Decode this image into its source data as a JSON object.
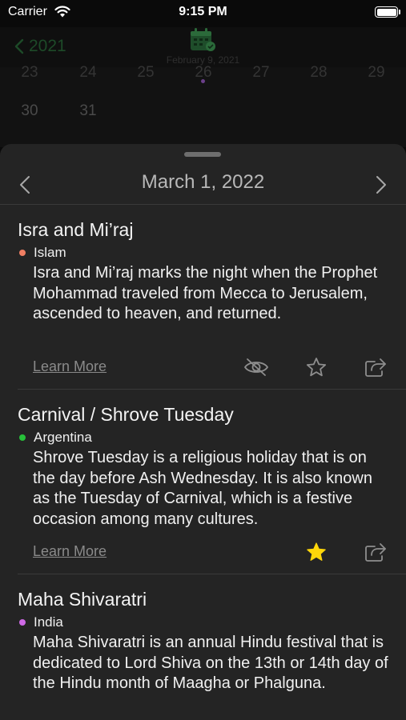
{
  "status_bar": {
    "carrier": "Carrier",
    "time": "9:15 PM",
    "battery_level": 1.0
  },
  "background_calendar": {
    "back_label": "2021",
    "selected_date": "February 9, 2021",
    "partial_row": [
      "23",
      "24",
      "25",
      "26",
      "27",
      "28",
      "29"
    ],
    "last_row": [
      "30",
      "31"
    ]
  },
  "sheet": {
    "date_title": "March 1, 2022",
    "prev_icon": "chevron-left-icon",
    "next_icon": "chevron-right-icon"
  },
  "events": [
    {
      "title": "Isra and Mi’raj",
      "tag": "Islam",
      "tag_color": "#f07f63",
      "description": "Isra and Mi’raj marks the night when the Prophet Mohammad traveled from Mecca to Jerusalem, ascended to heaven, and returned.",
      "learn_more": "Learn More",
      "hidden_toggle": true,
      "favorited": false
    },
    {
      "title": "Carnival / Shrove Tuesday",
      "tag": "Argentina",
      "tag_color": "#27c13a",
      "description": "Shrove Tuesday is a religious holiday that is on the day before Ash Wednesday. It is also known as the Tuesday of Carnival, which is a festive occasion among many cultures.",
      "learn_more": "Learn More",
      "favorited": true
    },
    {
      "title": "Maha Shivaratri",
      "tag": "India",
      "tag_color": "#cf6ae6",
      "description": "Maha Shivaratri is an annual Hindu festival that is dedicated to Lord Shiva on the 13th or 14th day of the Hindu month of Maagha or Phalguna."
    }
  ],
  "colors": {
    "sheet_bg": "#242424",
    "star_active": "#ffd60a",
    "icon_gray": "#8e8e8e"
  }
}
